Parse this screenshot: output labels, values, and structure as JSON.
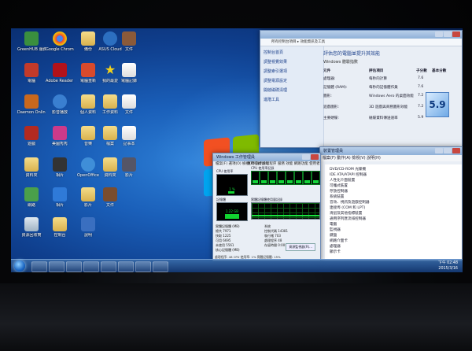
{
  "desktop": {
    "icons": [
      {
        "label": "GreenHUB 服務"
      },
      {
        "label": "Google Chrome"
      },
      {
        "label": "備份"
      },
      {
        "label": "ASUS Cloud"
      },
      {
        "label": "文件"
      },
      {
        "label": "電腦"
      },
      {
        "label": "Adobe Reader XI"
      },
      {
        "label": "電腦重新"
      },
      {
        "label": "我的最愛"
      },
      {
        "label": "電腦記錄"
      },
      {
        "label": "Daemon Online"
      },
      {
        "label": "影音播放"
      },
      {
        "label": "個人資料"
      },
      {
        "label": "工作資料"
      },
      {
        "label": "文件"
      },
      {
        "label": "遊戲"
      },
      {
        "label": "美圖秀秀"
      },
      {
        "label": "音樂"
      },
      {
        "label": "檔案"
      },
      {
        "label": "記事本"
      },
      {
        "label": "資料夾"
      },
      {
        "label": "相片"
      },
      {
        "label": "OpenOffice"
      },
      {
        "label": "資料夾"
      },
      {
        "label": "影片"
      },
      {
        "label": "網路"
      },
      {
        "label": "相片"
      },
      {
        "label": "影片"
      },
      {
        "label": "文件"
      },
      {
        "label": "資源回收筒"
      },
      {
        "label": "控制台"
      },
      {
        "label": "說明"
      }
    ]
  },
  "sysinfo": {
    "title": "",
    "address": "所有控制台項目 ▸ 效能資訊及工具",
    "heading": "評估您的電腦並提升其效能",
    "side_links": [
      "控制台首頁",
      "調整視覺效果",
      "調整索引選項",
      "調整電源設定",
      "開啟磁碟清理",
      "進階工具"
    ],
    "windows_text": "Windows 體驗指數",
    "columns": [
      "元件",
      "評估項目",
      "子分數",
      "基本分數"
    ],
    "rows": [
      {
        "component": "處理器:",
        "desc": "每秒的計算",
        "score": "7.6"
      },
      {
        "component": "記憶體 (RAM):",
        "desc": "每秒的記憶體作業",
        "score": "7.6"
      },
      {
        "component": "圖形:",
        "desc": "Windows Aero 的桌面效能",
        "score": "7.2"
      },
      {
        "component": "遊戲圖形:",
        "desc": "3D 遊戲與商務圖形效能",
        "score": "7.2"
      },
      {
        "component": "主要硬碟:",
        "desc": "磁碟資料傳送速率",
        "score": "5.9"
      }
    ],
    "base_score": "5.9"
  },
  "taskmgr": {
    "title": "Windows 工作管理員",
    "menu": "檔案(F) 選項(O) 檢視(V) 說明(H)",
    "tabs": "應用程式 處理程序 服務 效能 網路功能 使用者",
    "cpu_usage_label": "CPU 使用率",
    "cpu_history_label": "CPU 使用率記錄",
    "mem_label": "記憶體",
    "mem_history_label": "實體記憶體使用量記錄",
    "cpu_percent": "1 %",
    "mem_value": "1.22 GB",
    "stats_left": [
      "實體記憶體 (MB)",
      "總共  7971",
      "快取  1225",
      "可用  6695",
      "未使用 5561"
    ],
    "stats_mid": [
      "系統",
      "控制代碼 14381",
      "執行緒 703",
      "處理程序 48",
      "存留時間 0:00:03:42"
    ],
    "kernel": "核心記憶體 (MB)",
    "resource_button": "資源監視器(R)...",
    "status": "處理程序: 48   CPU 使用率: 1%   實體記憶體: 15%"
  },
  "devmgr": {
    "title": "裝置管理員",
    "menu": "檔案(F)  動作(A)  檢視(V)  說明(H)",
    "tree": [
      "DVD/CD-ROM 光碟機",
      "IDE ATA/ATAPI 控制器",
      "人性化介面裝置",
      "可攜式裝置",
      "存放控制器",
      "系統裝置",
      "音效、視訊及遊戲控制器",
      "連接埠 (COM 和 LPT)",
      "滑鼠及其他指標裝置",
      "通用序列匯流排控制器",
      "電腦",
      "監視器",
      "鍵盤",
      "網路介面卡",
      "處理器",
      "顯示卡"
    ]
  },
  "taskbar": {
    "clock_time": "下午 02:48",
    "clock_date": "2015/3/16"
  }
}
